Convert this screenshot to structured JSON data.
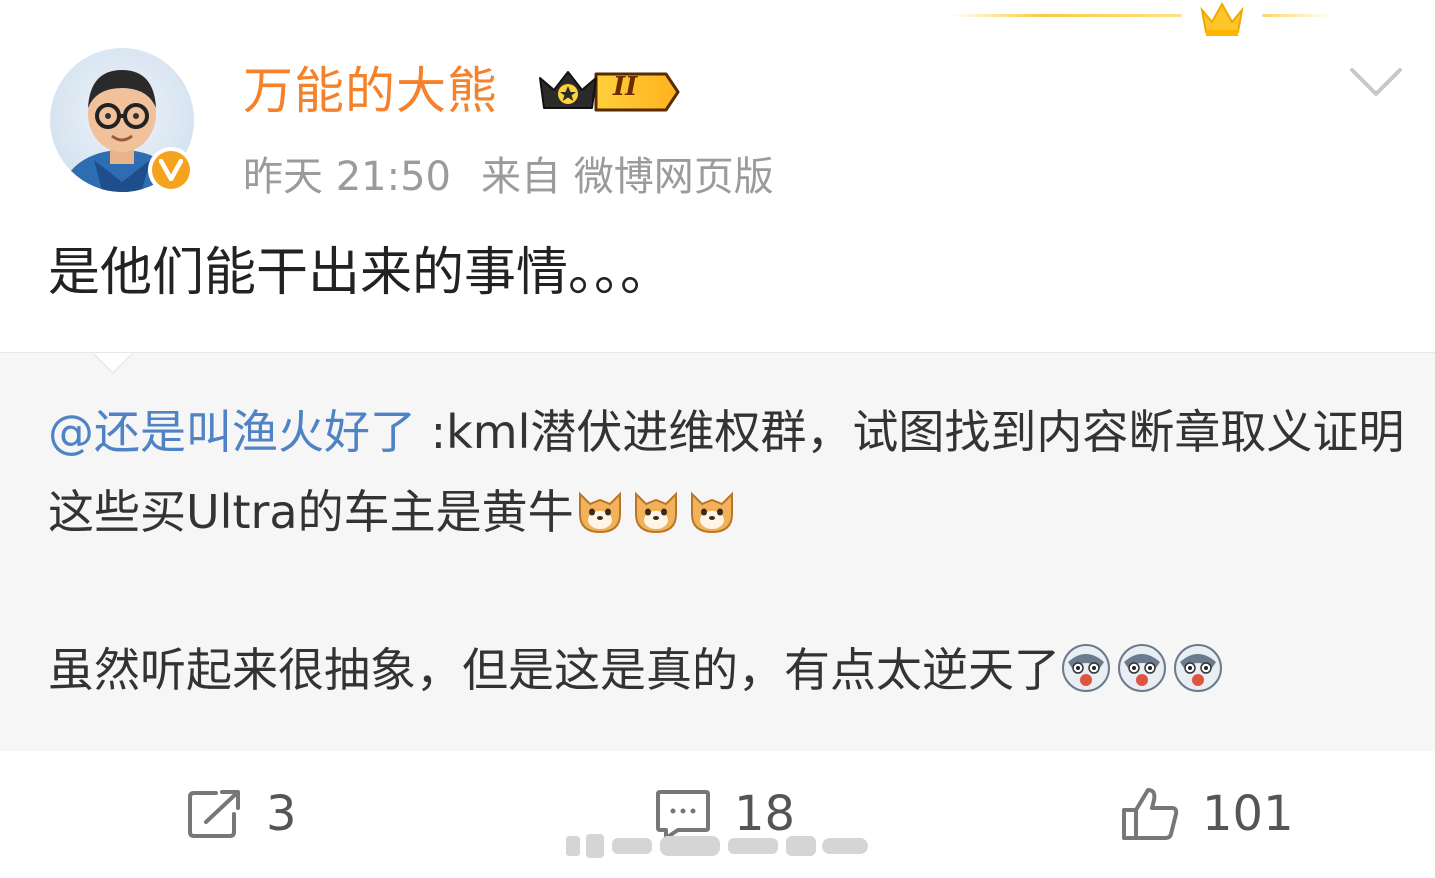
{
  "author": {
    "name": "万能的大熊",
    "vip_level": "II",
    "time": "昨天 21:50",
    "source": "来自 微博网页版"
  },
  "post": {
    "text": "是他们能干出来的事情。。。"
  },
  "repost": {
    "mention": "@还是叫渔火好了",
    "line1_rest": " :kml潜伏进维权群，试图找到内容断章取义证明这些买Ultra的车主是黄牛",
    "line2": "虽然听起来很抽象，但是这是真的，有点太逆天了",
    "emoji_1": "doge-icon",
    "emoji_2": "husky-icon"
  },
  "actions": {
    "repost_count": "3",
    "comment_count": "18",
    "like_count": "101"
  },
  "colors": {
    "username": "#f5822b",
    "mention": "#4f83c5",
    "repost_bg": "#f6f6f6",
    "meta_text": "#9b9b9b"
  }
}
